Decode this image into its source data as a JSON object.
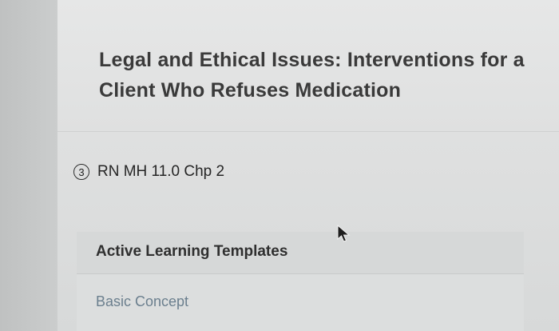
{
  "lesson": {
    "title": "Legal and Ethical Issues: Interventions for a Client Who Refuses Medication",
    "badge_number": "3",
    "source": "RN MH 11.0 Chp 2"
  },
  "section": {
    "title": "Active Learning Templates",
    "items": [
      "Basic Concept"
    ]
  },
  "icons": {
    "badge": "numbered-circle-icon",
    "cursor": "mouse-pointer-icon"
  },
  "colors": {
    "title_text": "#3a3a3a",
    "link_text": "#6b7f8e",
    "background": "#d9dbdb"
  }
}
